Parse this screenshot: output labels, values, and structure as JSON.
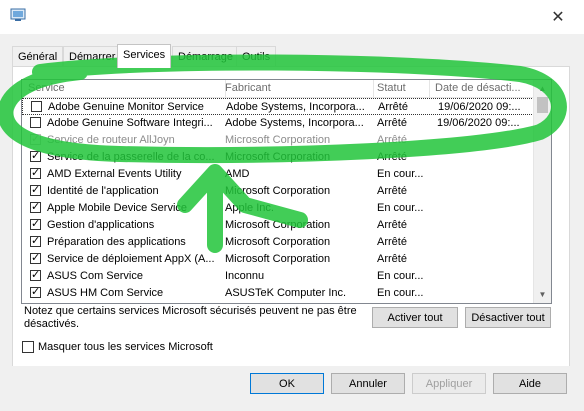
{
  "window": {
    "close_glyph": "✕"
  },
  "tabs": [
    {
      "label": "Général",
      "active": false
    },
    {
      "label": "Démarrer",
      "active": false
    },
    {
      "label": "Services",
      "active": true
    },
    {
      "label": "Démarrage",
      "active": false
    },
    {
      "label": "Outils",
      "active": false
    }
  ],
  "columns": [
    "Service",
    "Fabricant",
    "Statut",
    "Date de désacti..."
  ],
  "rows": [
    {
      "service": "Adobe Genuine Monitor Service",
      "maker": "Adobe Systems, Incorpora...",
      "status": "Arrêté",
      "date": "19/06/2020 09:...",
      "checked": false,
      "disabled": false
    },
    {
      "service": "Adobe Genuine Software Integri...",
      "maker": "Adobe Systems, Incorpora...",
      "status": "Arrêté",
      "date": "19/06/2020 09:...",
      "checked": false,
      "disabled": false
    },
    {
      "service": "Service de routeur AllJoyn",
      "maker": "Microsoft Corporation",
      "status": "Arrêté",
      "date": "",
      "checked": true,
      "disabled": true
    },
    {
      "service": "Service de la passerelle de la co...",
      "maker": "Microsoft Corporation",
      "status": "Arrêté",
      "date": "",
      "checked": true,
      "disabled": false
    },
    {
      "service": "AMD External Events Utility",
      "maker": "AMD",
      "status": "En cour...",
      "date": "",
      "checked": true,
      "disabled": false
    },
    {
      "service": "Identité de l'application",
      "maker": "Microsoft Corporation",
      "status": "Arrêté",
      "date": "",
      "checked": true,
      "disabled": false
    },
    {
      "service": "Apple Mobile Device Service",
      "maker": "Apple Inc.",
      "status": "En cour...",
      "date": "",
      "checked": true,
      "disabled": false
    },
    {
      "service": "Gestion d'applications",
      "maker": "Microsoft Corporation",
      "status": "Arrêté",
      "date": "",
      "checked": true,
      "disabled": false
    },
    {
      "service": "Préparation des applications",
      "maker": "Microsoft Corporation",
      "status": "Arrêté",
      "date": "",
      "checked": true,
      "disabled": false
    },
    {
      "service": "Service de déploiement AppX (A...",
      "maker": "Microsoft Corporation",
      "status": "Arrêté",
      "date": "",
      "checked": true,
      "disabled": false
    },
    {
      "service": "ASUS Com Service",
      "maker": "Inconnu",
      "status": "En cour...",
      "date": "",
      "checked": true,
      "disabled": false
    },
    {
      "service": "ASUS HM Com Service",
      "maker": "ASUSTeK Computer Inc.",
      "status": "En cour...",
      "date": "",
      "checked": true,
      "disabled": false
    }
  ],
  "note": "Notez que certains services Microsoft sécurisés peuvent ne pas être désactivés.",
  "buttons": {
    "enable_all": "Activer tout",
    "disable_all": "Désactiver tout",
    "ok": "OK",
    "cancel": "Annuler",
    "apply": "Appliquer",
    "help": "Aide"
  },
  "hide_ms_label": "Masquer tous les services Microsoft",
  "hide_ms_checked": false,
  "colors": {
    "annotation": "#21c43a",
    "selection_border": "#333333"
  }
}
